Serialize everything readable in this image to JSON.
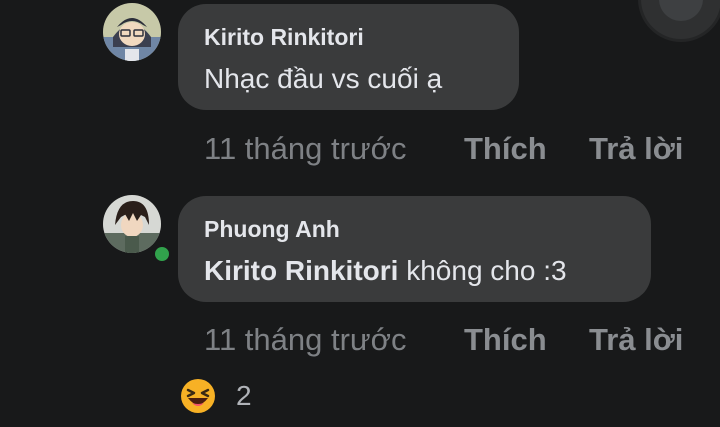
{
  "comments": [
    {
      "author": "Kirito Rinkitori",
      "text": "Nhạc đầu vs cuối ạ",
      "mention": "",
      "time": "11 tháng trước",
      "like_label": "Thích",
      "reply_label": "Trả lời",
      "online": false
    },
    {
      "author": "Phuong Anh",
      "mention": "Kirito Rinkitori",
      "text": " không cho :3",
      "time": "11 tháng trước",
      "like_label": "Thích",
      "reply_label": "Trả lời",
      "online": true
    }
  ],
  "reactions": {
    "icon": "haha-emoji-icon",
    "count": "2"
  },
  "colors": {
    "background": "#18191a",
    "bubble": "#3a3b3c",
    "text": "#e4e6eb",
    "meta": "#8a8d91",
    "online": "#31a24c",
    "reaction": "#f7b125"
  }
}
